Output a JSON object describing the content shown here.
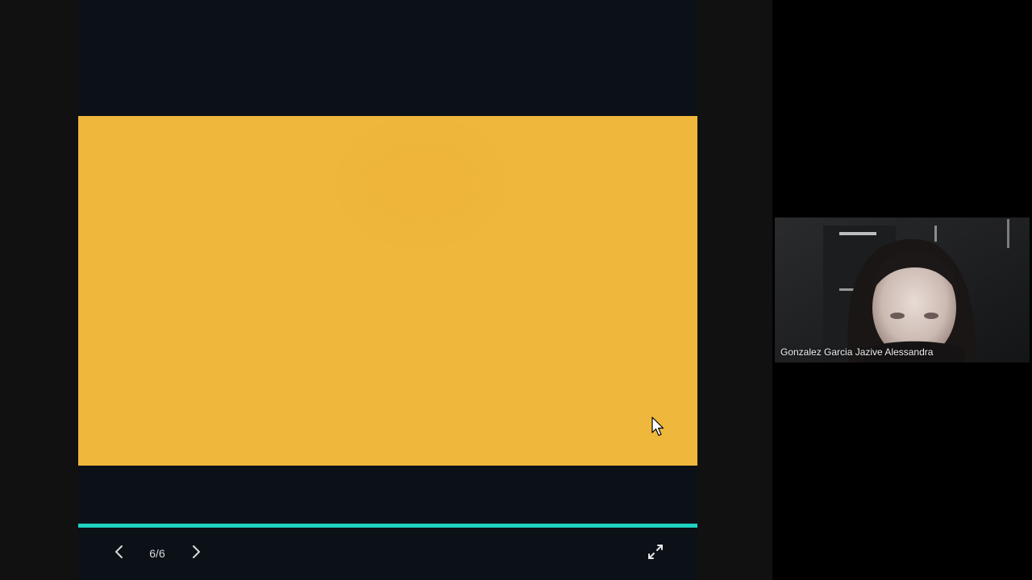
{
  "presentation": {
    "page_counter": "6/6",
    "progress_fraction": 1.0,
    "slide_color": "#efb73b",
    "accent_color": "#1fd1c1",
    "prev_icon": "chevron-left-icon",
    "next_icon": "chevron-right-icon",
    "fullscreen_icon": "expand-icon"
  },
  "participant": {
    "name": "Gonzalez Garcia Jazive Alessandra"
  }
}
